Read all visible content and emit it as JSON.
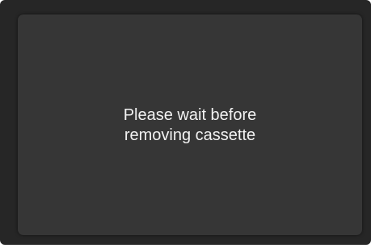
{
  "dialog": {
    "message": "Please wait before\nremoving cassette"
  }
}
